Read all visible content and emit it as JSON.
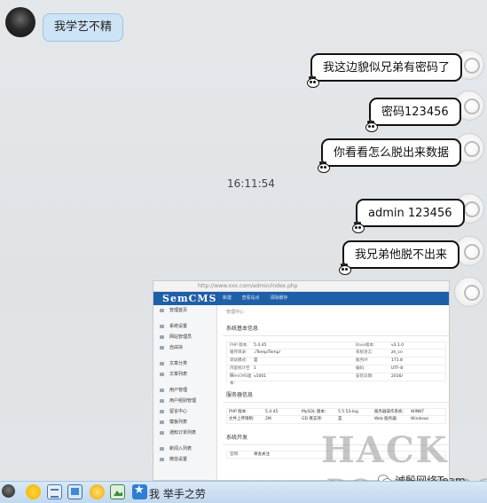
{
  "messages": [
    {
      "side": "left",
      "text": "我学艺不精"
    },
    {
      "side": "right",
      "text": "我这边貌似兄弟有密码了"
    },
    {
      "side": "right",
      "text": "密码123456"
    },
    {
      "side": "right",
      "text": "你看看怎么脱出来数据"
    },
    {
      "side": "right",
      "text": "admin 123456"
    },
    {
      "side": "right",
      "text": "我兄弟他脱不出来"
    }
  ],
  "timestamp": "16:11:54",
  "screenshot": {
    "url_text": "http://www.xxx.com/admin/index.php",
    "logo": "SemCMS",
    "top_links": [
      "新建",
      "查看站点",
      "清除缓存"
    ],
    "breadcrumb": "管理中心",
    "sidebar": [
      "管理首页",
      "系统设置",
      "网站管理员",
      "自由块",
      "文章分类",
      "文章列表",
      "用户管理",
      "用户组别管理",
      "留言中心",
      "模板列表",
      "通知订单列表",
      "新闻入列表",
      "微信设置"
    ],
    "section_basic": "系统基本信息",
    "basic_rows": [
      [
        "PHP 版本:",
        "5.4.45",
        "Base版本:",
        "v3.1.0"
      ],
      [
        "缓存目录:",
        "./Temp/Temp/",
        "系统语言:",
        "zh_cn"
      ],
      [
        "调试模式:",
        "是",
        "服务IP:",
        "171.8"
      ],
      [
        "内容统计空间:",
        "1",
        "编码:",
        "UTF-8"
      ],
      [
        "SemCMS版本:",
        "v1001",
        "安装日期:",
        "2016/"
      ]
    ],
    "section_server": "服务器信息",
    "server_rows": [
      [
        "PHP 版本:",
        "5.4.45",
        "MySQL 版本:",
        "5.5.53-log",
        "服务器操作系统:",
        "WINNT"
      ],
      [
        "文件上传限制:",
        "2M",
        "GD 库支持:",
        "是",
        "Web 服务器:",
        "Windows"
      ]
    ],
    "section_dev": "系统开发",
    "dev_row": [
      "官网:",
      "将会关注"
    ]
  },
  "watermark": {
    "line1": "HACK",
    "line2": "DOOR.ORG"
  },
  "wechat_label": "诚殷网络Team",
  "bottom_text": "我 举手之劳"
}
